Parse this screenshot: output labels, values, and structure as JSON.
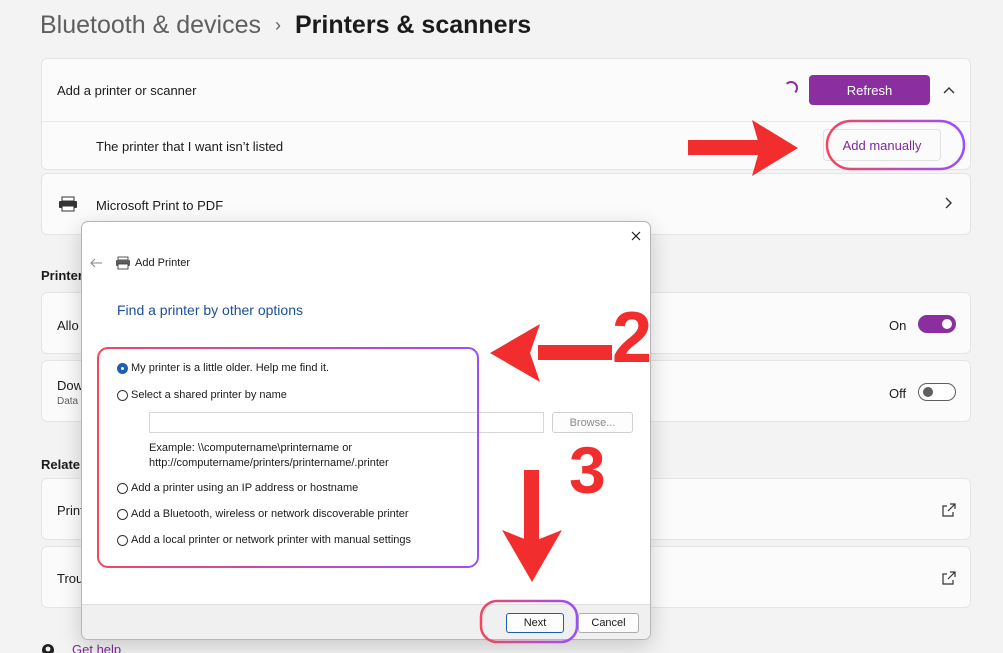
{
  "breadcrumb": {
    "parent": "Bluetooth & devices",
    "separator": "›",
    "current": "Printers & scanners"
  },
  "add_section": {
    "title": "Add a printer or scanner",
    "refresh_label": "Refresh",
    "not_listed": "The printer that I want isn’t listed",
    "add_manually_label": "Add manually"
  },
  "printers": [
    {
      "name": "Microsoft Print to PDF"
    }
  ],
  "preferences": {
    "heading": "Printer",
    "allow_label": "Allo",
    "allow_state": "On",
    "download_label": "Dow",
    "download_sub": "Data",
    "download_state": "Off"
  },
  "related": {
    "heading": "Relate",
    "item1": "Print",
    "item2": "Trou"
  },
  "help": {
    "get_help": "Get help"
  },
  "dialog": {
    "title": "Add Printer",
    "heading": "Find a printer by other options",
    "options": [
      "My printer is a little older. Help me find it.",
      "Select a shared printer by name",
      "Add a printer using an IP address or hostname",
      "Add a Bluetooth, wireless or network discoverable printer",
      "Add a local printer or network printer with manual settings"
    ],
    "selected_index": 0,
    "shared_input_value": "",
    "browse_label": "Browse...",
    "example_line1": "Example: \\\\computername\\printername or",
    "example_line2": "http://computername/printers/printername/.printer",
    "next_label": "Next",
    "cancel_label": "Cancel"
  },
  "annotations": {
    "label2": "2",
    "label3": "3"
  },
  "colors": {
    "accent": "#8a2ea0",
    "annotation_red": "#f22d2d",
    "annotation_gradient_start": "#f0485e",
    "annotation_gradient_end": "#9b4dff",
    "dialog_heading": "#1a4f9a"
  }
}
